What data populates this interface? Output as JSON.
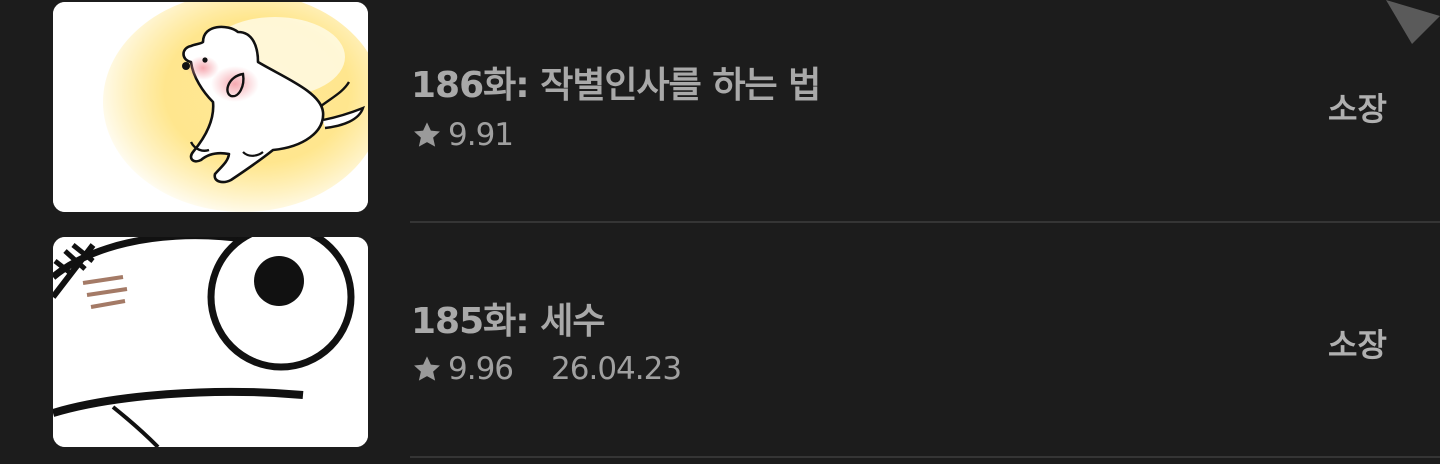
{
  "episodes": [
    {
      "title": "186화: 작별인사를 하는 법",
      "rating": "9.91",
      "date": "",
      "status": "소장",
      "thumbnail": "white-dog-glowing-thumbnail"
    },
    {
      "title": "185화: 세수",
      "rating": "9.96",
      "date": "26.04.23",
      "status": "소장",
      "thumbnail": "face-closeup-eye-thumbnail"
    }
  ],
  "icons": {
    "rating": "star-icon",
    "corner": "triangle-arrow-icon"
  },
  "colors": {
    "background": "#1c1c1c",
    "text": "#a9a9a9",
    "divider": "#353535"
  }
}
